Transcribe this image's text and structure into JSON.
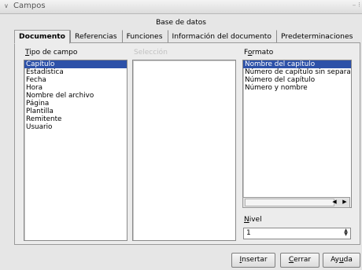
{
  "window": {
    "title": "Campos",
    "menu_glyph": "∨",
    "controls": "– ⁝"
  },
  "tabs": {
    "group_label": "Base de datos",
    "items": [
      {
        "label": "Documento",
        "active": true
      },
      {
        "label": "Referencias",
        "active": false
      },
      {
        "label": "Funciones",
        "active": false
      },
      {
        "label": "Información del documento",
        "active": false
      },
      {
        "label": "Predeterminaciones",
        "active": false
      }
    ]
  },
  "tipo_de_campo": {
    "label_u": "T",
    "label_rest": "ipo de campo",
    "items": [
      "Capítulo",
      "Estadística",
      "Fecha",
      "Hora",
      "Nombre del archivo",
      "Página",
      "Plantilla",
      "Remitente",
      "Usuario"
    ],
    "selected_index": 0
  },
  "seleccion": {
    "label": "Selección",
    "items": []
  },
  "formato": {
    "label_pre": "F",
    "label_u": "o",
    "label_rest": "rmato",
    "items": [
      "Nombre del capítulo",
      "Número de capítulo sin separa",
      "Número del capítulo",
      "Número y nombre"
    ],
    "selected_index": 0
  },
  "scrollbar": {
    "left_arrow": "◀",
    "right_arrow": "▶",
    "position": 0.0
  },
  "nivel": {
    "label_u": "N",
    "label_rest": "ivel",
    "value": "1",
    "up": "▲",
    "down": "▼"
  },
  "buttons": {
    "insertar": {
      "u": "I",
      "rest": "nsertar"
    },
    "cerrar": {
      "u": "C",
      "rest": "errar"
    },
    "ayuda": {
      "pre": "Ay",
      "u": "u",
      "rest": "da"
    }
  }
}
